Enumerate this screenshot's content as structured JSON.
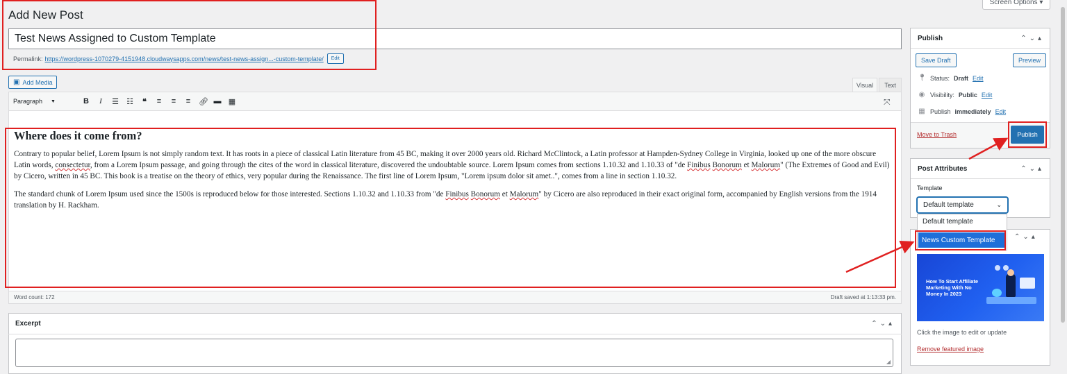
{
  "header": {
    "title": "Add New Post",
    "screen_options": "Screen Options ▾"
  },
  "post": {
    "title": "Test News Assigned to Custom Template",
    "permalink_label": "Permalink:",
    "permalink_url": "https://wordpress-1070279-4151948.cloudwaysapps.com/news/test-news-assign...-custom-template/",
    "edit_label": "Edit"
  },
  "editor": {
    "add_media": "Add Media",
    "tab_visual": "Visual",
    "tab_text": "Text",
    "format": "Paragraph",
    "heading": "Where does it come from?",
    "p1_a": "Contrary to popular belief, Lorem Ipsum is not simply random text. It has roots in a piece of classical Latin literature from 45 BC, making it over 2000 years old. Richard McClintock, a Latin professor at Hampden-Sydney College in Virginia, looked up one of the more obscure Latin words, ",
    "p1_w1": "consectetur",
    "p1_b": ", from a Lorem Ipsum passage, and going through the cites of the word in classical literature, discovered the undoubtable source. Lorem Ipsum comes from sections 1.10.32 and 1.10.33 of \"de ",
    "p1_w2": "Finibus",
    "p1_c": " ",
    "p1_w3": "Bonorum",
    "p1_d": " et ",
    "p1_w4": "Malorum",
    "p1_e": "\" (The Extremes of Good and Evil) by Cicero, written in 45 BC. This book is a treatise on the theory of ethics, very popular during the Renaissance. The first line of Lorem Ipsum, \"Lorem ipsum dolor sit amet..\", comes from a line in section 1.10.32.",
    "p2_a": "The standard chunk of Lorem Ipsum used since the 1500s is reproduced below for those interested. Sections 1.10.32 and 1.10.33 from \"de ",
    "p2_w1": "Finibus",
    "p2_b": " ",
    "p2_w2": "Bonorum",
    "p2_c": " et ",
    "p2_w3": "Malorum",
    "p2_d": "\" by Cicero are also reproduced in their exact original form, accompanied by English versions from the 1914 translation by H. Rackham.",
    "word_count": "Word count: 172",
    "draft_saved": "Draft saved at 1:13:33 pm."
  },
  "excerpt": {
    "title": "Excerpt"
  },
  "publish": {
    "title": "Publish",
    "save_draft": "Save Draft",
    "preview": "Preview",
    "status_label": "Status:",
    "status_value": "Draft",
    "visibility_label": "Visibility:",
    "visibility_value": "Public",
    "publish_when": "Publish",
    "publish_when_value": "immediately",
    "edit": "Edit",
    "trash": "Move to Trash",
    "publish_button": "Publish"
  },
  "attributes": {
    "title": "Post Attributes",
    "template_label": "Template",
    "selected": "Default template",
    "options": [
      "Default template",
      "News Custom Template"
    ]
  },
  "featured": {
    "image_text": "How To Start Affiliate Marketing With No Money In 2023",
    "note": "Click the image to edit or update",
    "remove": "Remove featured image"
  },
  "colors": {
    "accent": "#2271b1",
    "annotation": "#e02020",
    "danger": "#b32d2e"
  }
}
